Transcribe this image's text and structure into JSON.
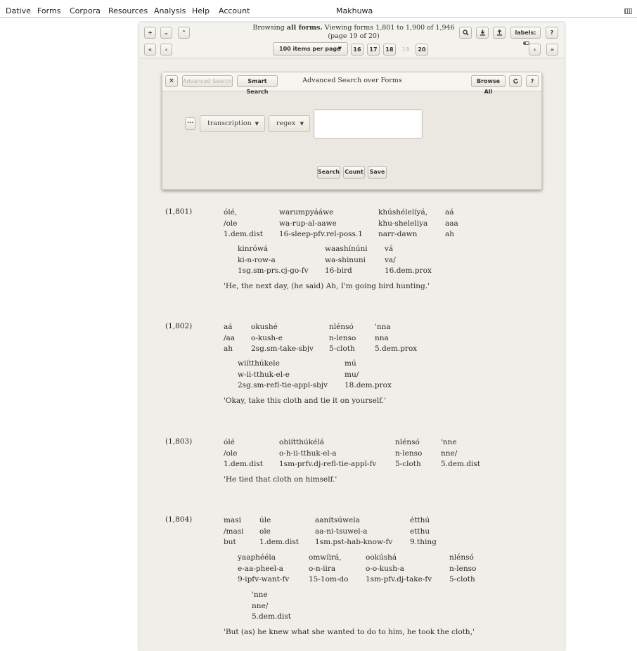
{
  "menubar": {
    "items": [
      "Dative",
      "Forms",
      "Corpora",
      "Resources",
      "Analysis",
      "Help",
      "Account"
    ],
    "app_name": "Makhuwa",
    "keyboard_icon": "keyboard-icon"
  },
  "browse": {
    "browsing_prefix": "Browsing",
    "browsing_bold": "all forms.",
    "viewing": "Viewing forms 1,801 to 1,900 of 1,946",
    "page_info": "(page 19 of 20)",
    "items_per_page": "100 items per page",
    "pages": [
      "16",
      "17",
      "18",
      "19",
      "20"
    ],
    "current_page": "19",
    "labels_button": "labels:",
    "help": "?",
    "icons": {
      "add": "+",
      "collapse": "⌄",
      "expand": "⌃",
      "first": "«",
      "prev": "‹",
      "next": "›",
      "last": "»",
      "search": "search-icon",
      "download": "download-icon",
      "upload": "upload-icon"
    }
  },
  "advanced_search": {
    "close": "×",
    "advanced_tab": "Advanced Search",
    "smart_tab": "Smart Search",
    "title": "Advanced Search over Forms",
    "browse_all": "Browse All",
    "help": "?",
    "more": "···",
    "field": "transcription",
    "operator": "regex",
    "query_value": "",
    "search_button": "Search",
    "count_button": "Count",
    "save_button": "Save"
  },
  "entries": [
    {
      "number": "(1,801)",
      "lines": [
        [
          {
            "t": "ólé,",
            "m": "/ole",
            "g": "1.dem.dist"
          },
          {
            "t": "warumpyááwe",
            "m": "wa-rup-al-aawe",
            "g": "16-sleep-pfv.rel-poss.1"
          },
          {
            "t": "khúshélelíyá,",
            "m": "khu-sheleliya",
            "g": "narr-dawn"
          },
          {
            "t": "aá",
            "m": "aaa",
            "g": "ah"
          }
        ],
        [
          {
            "t": "kinrówá",
            "m": "ki-n-row-a",
            "g": "1sg.sm-prs.cj-go-fv"
          },
          {
            "t": "waashínúni",
            "m": "wa-shinuni",
            "g": "16-bird"
          },
          {
            "t": "vá",
            "m": "va/",
            "g": "16.dem.prox"
          }
        ]
      ],
      "translation": "'He, the next day, (he said) Ah, I'm going bird hunting.'"
    },
    {
      "number": "(1,802)",
      "lines": [
        [
          {
            "t": "aá",
            "m": "/aa",
            "g": "ah"
          },
          {
            "t": "okushé",
            "m": "o-kush-e",
            "g": "2sg.sm-take-sbjv"
          },
          {
            "t": "nlénsó",
            "m": "n-lenso",
            "g": "5-cloth"
          },
          {
            "t": "'nna",
            "m": "nna",
            "g": "5.dem.prox"
          }
        ],
        [
          {
            "t": "wiítthúkele",
            "m": "w-ii-tthuk-el-e",
            "g": "2sg.sm-refl-tie-appl-sbjv"
          },
          {
            "t": "mú",
            "m": "mu/",
            "g": "18.dem.prox"
          }
        ]
      ],
      "translation": "'Okay, take this cloth and tie it on yourself.'"
    },
    {
      "number": "(1,803)",
      "lines": [
        [
          {
            "t": "ólé",
            "m": "/ole",
            "g": "1.dem.dist"
          },
          {
            "t": "ohiítthúkélá",
            "m": "o-h-ii-tthuk-el-a",
            "g": "1sm-prfv.dj-refl-tie-appl-fv"
          },
          {
            "t": "nlénsó",
            "m": "n-lenso",
            "g": "5-cloth"
          },
          {
            "t": "'nne",
            "m": "nne/",
            "g": "5.dem.dist"
          }
        ]
      ],
      "translation": "'He tied that cloth on himself.'"
    },
    {
      "number": "(1,804)",
      "lines": [
        [
          {
            "t": "masi",
            "m": "/masi",
            "g": "but"
          },
          {
            "t": "úle",
            "m": "ole",
            "g": "1.dem.dist"
          },
          {
            "t": "aanítsúwela",
            "m": "aa-ni-tsuwel-a",
            "g": "1sm.pst-hab-know-fv"
          },
          {
            "t": "étthú",
            "m": "etthu",
            "g": "9.thing"
          }
        ],
        [
          {
            "t": "yaaphééla",
            "m": "e-aa-pheel-a",
            "g": "9-ipfv-want-fv"
          },
          {
            "t": "omwíirá,",
            "m": "o-n-iira",
            "g": "15-1om-do"
          },
          {
            "t": "ookúshá",
            "m": "o-o-kush-a",
            "g": "1sm-pfv.dj-take-fv"
          },
          {
            "t": "nlénsó",
            "m": "n-lenso",
            "g": "5-cloth"
          }
        ],
        [
          {
            "t": "'nne",
            "m": "nne/",
            "g": "5.dem.dist"
          }
        ]
      ],
      "translation": "'But (as) he knew what she wanted to do to him, he took the cloth,'"
    }
  ]
}
